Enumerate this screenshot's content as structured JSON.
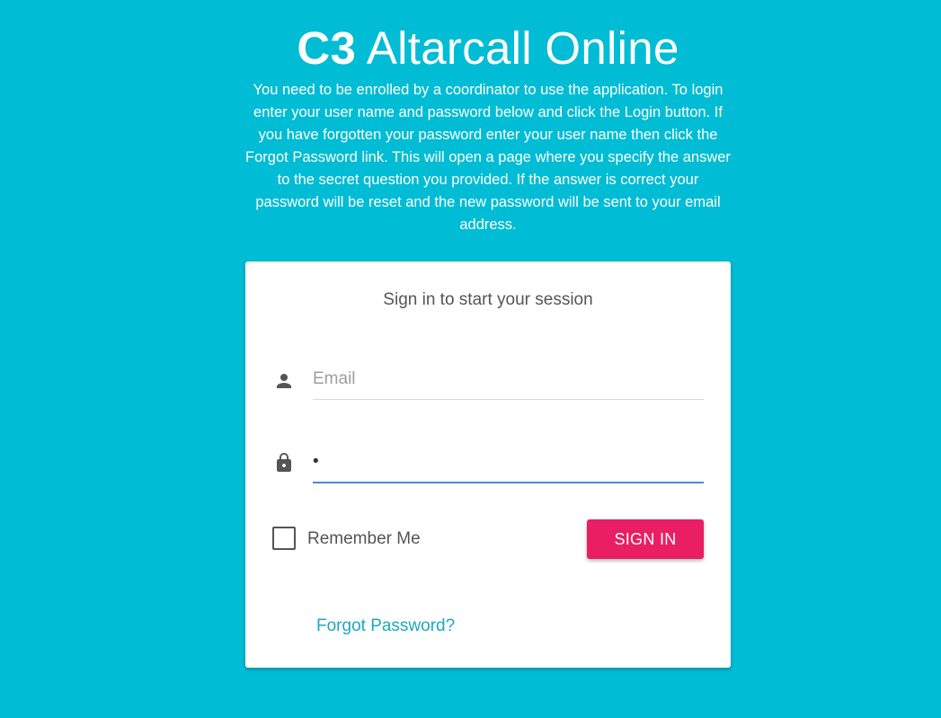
{
  "header": {
    "brand": "C3",
    "title_rest": " Altarcall Online",
    "intro": "You need to be enrolled by a coordinator to use the application. To login enter your user name and password below and click the Login button. If you have forgotten your password enter your user name then click the Forgot Password link. This will open a page where you specify the answer to the secret question you provided. If the answer is correct your password will be reset and the new password will be sent to your email address."
  },
  "login": {
    "title": "Sign in to start your session",
    "email_placeholder": "Email",
    "email_value": "",
    "password_value": "•",
    "remember_label": "Remember Me",
    "remember_checked": false,
    "signin_label": "SIGN IN",
    "forgot_label": "Forgot Password?"
  },
  "icons": {
    "email": "person-icon",
    "password": "lock-icon"
  },
  "colors": {
    "background": "#00bcd4",
    "accent": "#e91e63",
    "link": "#1ea8c0",
    "focus": "#3f8fdc"
  }
}
